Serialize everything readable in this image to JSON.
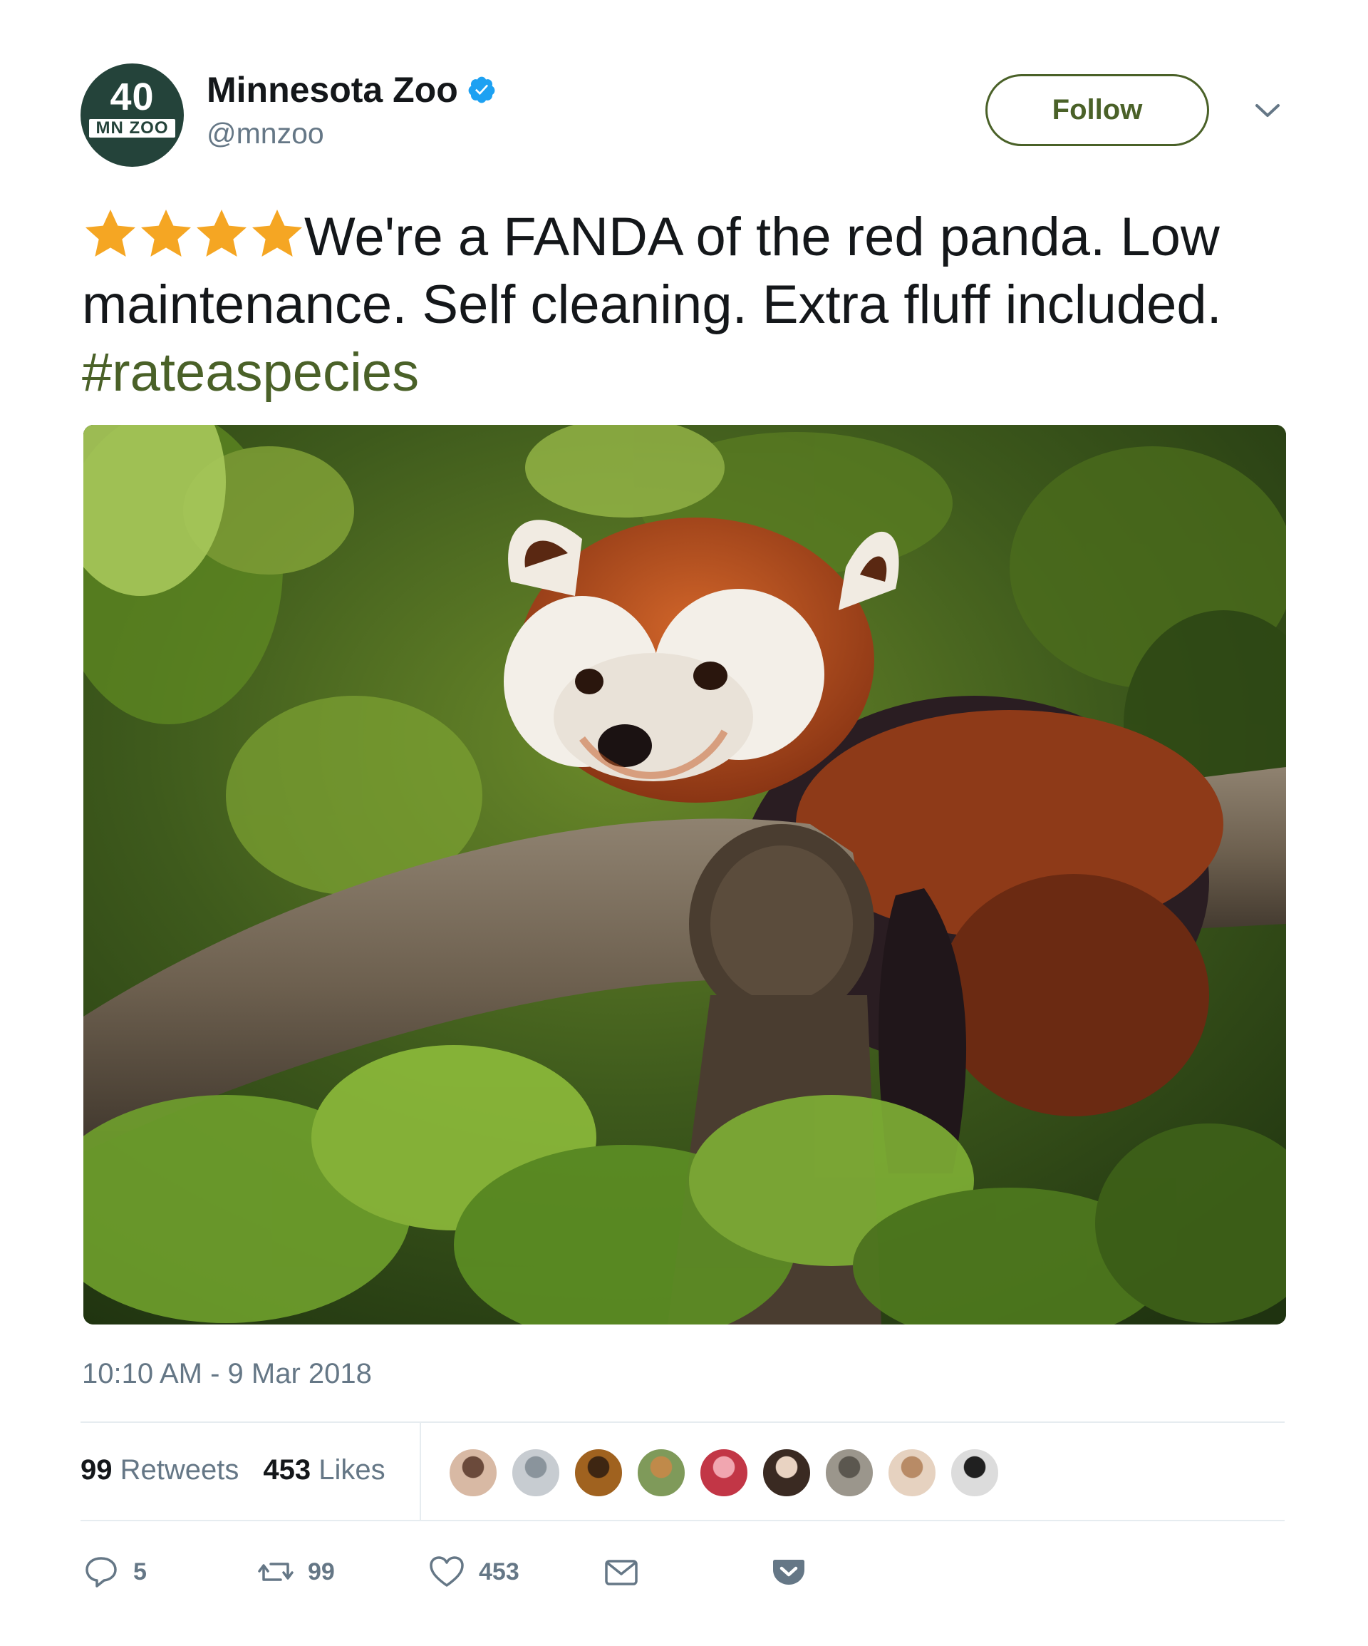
{
  "account": {
    "display_name": "Minnesota Zoo",
    "handle": "@mnzoo",
    "avatar_number": "40",
    "avatar_brand": "MN ZOO",
    "verified_icon": "verified-badge-icon"
  },
  "header": {
    "follow_label": "Follow",
    "more_icon": "chevron-down-icon"
  },
  "tweet": {
    "rating_stars": 4,
    "star_color": "#f5a623",
    "text": "We're a FANDA of the red panda. Low maintenance. Self cleaning. Extra fluff included.",
    "hashtag": "#rateaspecies",
    "accent_color": "#4a6128"
  },
  "timestamp": "10:10 AM - 9 Mar 2018",
  "stats": {
    "retweets_count": "99",
    "retweets_label": "Retweets",
    "likes_count": "453",
    "likes_label": "Likes",
    "likers": [
      "liker-avatar-1",
      "liker-avatar-2",
      "liker-avatar-3",
      "liker-avatar-4",
      "liker-avatar-5",
      "liker-avatar-6",
      "liker-avatar-7",
      "liker-avatar-8",
      "liker-avatar-9"
    ]
  },
  "actions": {
    "reply_count": "5",
    "retweet_count": "99",
    "like_count": "453",
    "reply_icon": "reply-icon",
    "retweet_icon": "retweet-icon",
    "like_icon": "heart-icon",
    "message_icon": "envelope-icon",
    "pocket_icon": "pocket-icon"
  }
}
